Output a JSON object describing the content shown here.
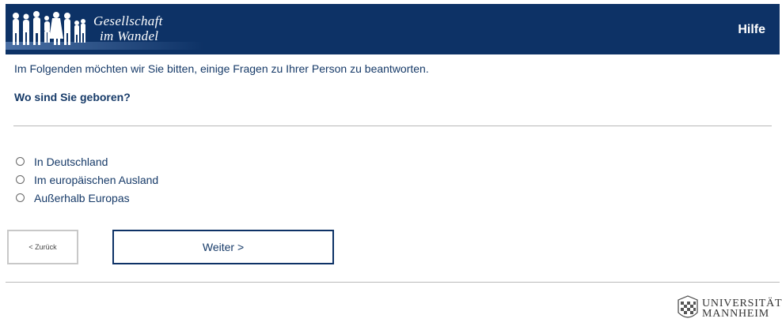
{
  "header": {
    "logo_line1": "Gesellschaft",
    "logo_line2": "im Wandel",
    "help_label": "Hilfe"
  },
  "main": {
    "intro": "Im Folgenden möchten wir Sie bitten, einige Fragen zu Ihrer Person zu beantworten.",
    "question": "Wo sind Sie geboren?",
    "options": [
      {
        "label": "In Deutschland",
        "selected": false
      },
      {
        "label": "Im europäischen Ausland",
        "selected": false
      },
      {
        "label": "Außerhalb Europas",
        "selected": false
      }
    ]
  },
  "navigation": {
    "back_label": "< Zurück",
    "next_label": "Weiter >"
  },
  "footer": {
    "university_line1": "UNIVERSITÄT",
    "university_line2": "MANNHEIM"
  },
  "colors": {
    "brand_navy": "#0d3266",
    "text_blue": "#163a68",
    "separator": "#b9b9b9"
  }
}
